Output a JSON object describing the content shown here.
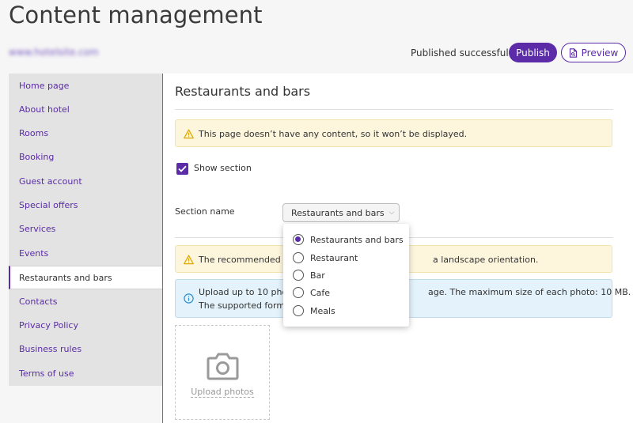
{
  "header": {
    "title": "Content management",
    "site_url": "www.hotelsite.com",
    "status": "Published successfully",
    "publish_label": "Publish",
    "preview_label": "Preview"
  },
  "sidebar": {
    "items": [
      {
        "label": "Home page"
      },
      {
        "label": "About hotel"
      },
      {
        "label": "Rooms"
      },
      {
        "label": "Booking"
      },
      {
        "label": "Guest account"
      },
      {
        "label": "Special offers"
      },
      {
        "label": "Services"
      },
      {
        "label": "Events"
      },
      {
        "label": "Restaurants and bars",
        "active": true
      },
      {
        "label": "Contacts"
      },
      {
        "label": "Privacy Policy"
      },
      {
        "label": "Business rules"
      },
      {
        "label": "Terms of use"
      }
    ]
  },
  "main": {
    "section_title": "Restaurants and bars",
    "empty_warning": "This page doesn’t have any content, so it won’t be displayed.",
    "show_section_label": "Show section",
    "show_section_checked": true,
    "section_name_label": "Section name",
    "section_name_value": "Restaurants and bars",
    "dropdown_options": [
      {
        "label": "Restaurants and bars",
        "selected": true
      },
      {
        "label": "Restaurant",
        "selected": false
      },
      {
        "label": "Bar",
        "selected": false
      },
      {
        "label": "Cafe",
        "selected": false
      },
      {
        "label": "Meals",
        "selected": false
      }
    ],
    "photo_warning_left": "The recommended r",
    "photo_warning_right": "a landscape orientation.",
    "info_line1_left": "Upload up to 10 pho",
    "info_line1_right": "age. The maximum size of each photo: 10 MB.",
    "info_line2_left": "The supported forma",
    "upload_label": "Upload photos"
  },
  "colors": {
    "accent": "#5b2ba8",
    "warning_bg": "#fdf6dd",
    "info_bg": "#e3f2fb"
  },
  "icons": {
    "warning": "warning-triangle-icon",
    "info": "info-circle-icon",
    "preview": "document-icon",
    "camera": "camera-icon",
    "chevron": "chevron-down-icon"
  }
}
